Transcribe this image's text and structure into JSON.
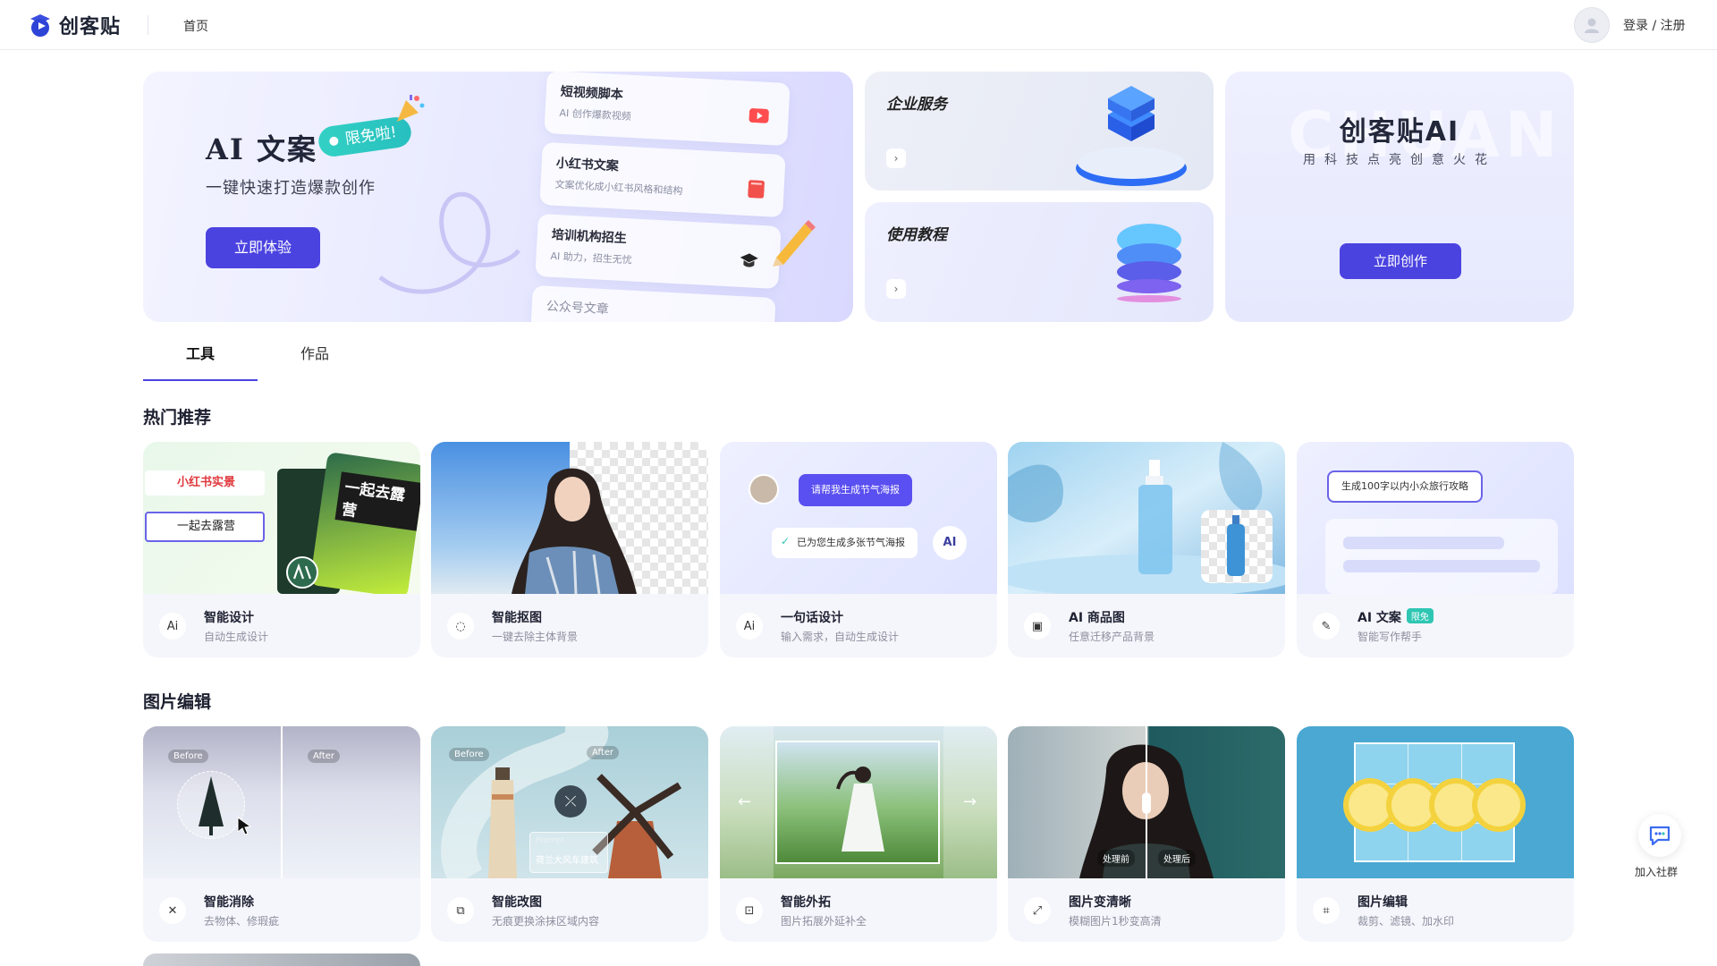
{
  "header": {
    "brand": "创客贴",
    "nav_home": "首页",
    "login_label": "登录 / 注册"
  },
  "banner_main": {
    "title": "AI 文案",
    "badge": "限免啦!",
    "subtitle": "一键快速打造爆款创作",
    "cta": "立即体验",
    "cards": [
      {
        "title": "短视频脚本",
        "sub": "AI 创作爆款视频"
      },
      {
        "title": "小红书文案",
        "sub": "文案优化成小红书风格和结构"
      },
      {
        "title": "培训机构招生",
        "sub": "AI 助力，招生无忧"
      },
      {
        "title": "公众号文章",
        "sub": ""
      }
    ]
  },
  "banner_enterprise": {
    "title": "企业服务",
    "arrow": "›"
  },
  "banner_tutorial": {
    "title": "使用教程",
    "arrow": "›"
  },
  "banner_ai": {
    "watermark": "CHUAN",
    "title": "创客贴AI",
    "subtitle": "用科技点亮创意火花",
    "cta": "立即创作"
  },
  "tabs": [
    {
      "label": "工具",
      "active": true
    },
    {
      "label": "作品",
      "active": false
    }
  ],
  "sections": {
    "hot": {
      "title": "热门推荐",
      "cards": [
        {
          "title": "智能设计",
          "sub": "自动生成设计",
          "icon": "ai-icon",
          "badge": "",
          "img_text_1": "小红书实景",
          "img_text_2": "一起去露营",
          "img_text_3": "一起去露营"
        },
        {
          "title": "智能抠图",
          "sub": "一键去除主体背景",
          "icon": "cutout-icon",
          "badge": ""
        },
        {
          "title": "一句话设计",
          "sub": "输入需求，自动生成设计",
          "icon": "ai-icon",
          "badge": "",
          "img_text_1": "请帮我生成节气海报",
          "img_text_2": "已为您生成多张节气海报"
        },
        {
          "title": "AI 商品图",
          "sub": "任意迁移产品背景",
          "icon": "product-icon",
          "badge": ""
        },
        {
          "title": "AI 文案",
          "sub": "智能写作帮手",
          "icon": "pen-icon",
          "badge": "限免",
          "img_text_1": "生成100字以内小众旅行攻略"
        }
      ]
    },
    "edit": {
      "title": "图片编辑",
      "cards": [
        {
          "title": "智能消除",
          "sub": "去物体、修瑕疵",
          "icon": "eraser-icon",
          "img_text_1": "Before",
          "img_text_2": "After"
        },
        {
          "title": "智能改图",
          "sub": "无痕更换涂抹区域内容",
          "icon": "edit-image-icon",
          "img_text_1": "Before",
          "img_text_2": "After",
          "img_text_3": "Prompt",
          "img_text_4": "荷兰大风车建筑"
        },
        {
          "title": "智能外拓",
          "sub": "图片拓展外延补全",
          "icon": "expand-icon"
        },
        {
          "title": "图片变清晰",
          "sub": "模糊图片1秒变高清",
          "icon": "enhance-icon",
          "img_text_1": "处理前",
          "img_text_2": "处理后"
        },
        {
          "title": "图片编辑",
          "sub": "裁剪、滤镜、加水印",
          "icon": "crop-icon"
        }
      ]
    }
  },
  "join_group": {
    "label": "加入社群"
  },
  "colors": {
    "brand": "#4b43e0",
    "accent_teal": "#2ec6b3",
    "card_bg": "#f5f6fb"
  }
}
